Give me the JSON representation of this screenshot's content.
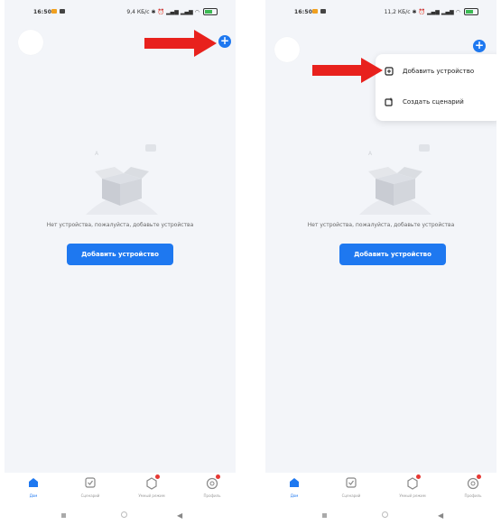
{
  "status_left": {
    "time": "16:50",
    "net_speed": "9,4 КБ/с"
  },
  "status_right": {
    "time": "16:50",
    "net_speed": "11,2 КБ/с"
  },
  "header": {
    "plus_icon": "plus-icon",
    "avatar_icon": "avatar"
  },
  "empty_state": {
    "message": "Нет устройства, пожалуйста, добавьте устройства",
    "button": "Добавить устройство"
  },
  "dropdown": {
    "items": [
      {
        "label": "Добавить устройство",
        "icon": "add-device-icon"
      },
      {
        "label": "Создать сценарий",
        "icon": "create-scene-icon"
      }
    ]
  },
  "nav": {
    "items": [
      {
        "label": "Дом",
        "icon": "home-icon",
        "active": true
      },
      {
        "label": "Сценарий",
        "icon": "scene-icon"
      },
      {
        "label": "Умный режим",
        "icon": "smart-mode-icon"
      },
      {
        "label": "Профиль",
        "icon": "profile-icon"
      }
    ]
  },
  "colors": {
    "accent": "#1e78f0",
    "arrow": "#e8211d",
    "background": "#f3f5f9"
  }
}
